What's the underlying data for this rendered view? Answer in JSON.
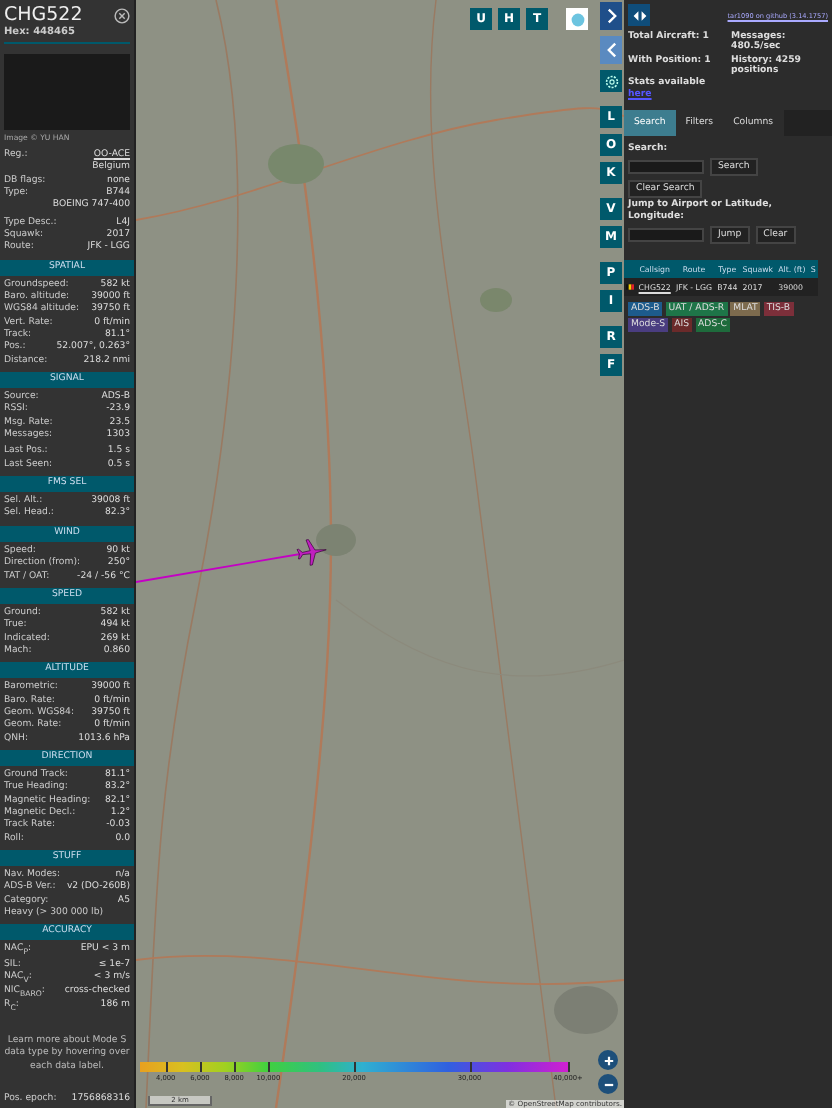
{
  "aircraft": {
    "callsign": "CHG522",
    "hex_label": "Hex:",
    "hex": "448465",
    "photo_credit": "Image © YU HAN"
  },
  "info_groups": [
    {
      "rows": [
        {
          "kind": "link",
          "label": "Reg.:",
          "value": "OO-ACE"
        },
        {
          "kind": "value",
          "value": "Belgium"
        },
        {
          "kind": "pair",
          "label": "DB flags:",
          "value": "none"
        },
        {
          "kind": "pair",
          "label": "Type:",
          "value": "B744"
        },
        {
          "kind": "value",
          "value": "BOEING 747-400"
        }
      ]
    },
    {
      "rows": [
        {
          "kind": "pair",
          "label": "Type Desc.:",
          "value": "L4J"
        },
        {
          "kind": "pair",
          "label": "Squawk:",
          "value": "2017"
        },
        {
          "kind": "pair",
          "label": "Route:",
          "value": "JFK - LGG"
        }
      ]
    }
  ],
  "sections": [
    {
      "title": "SPATIAL",
      "groups": [
        {
          "rows": [
            {
              "kind": "pair",
              "label": "Groundspeed:",
              "value": "582 kt"
            },
            {
              "kind": "pair",
              "label": "Baro. altitude:",
              "value": "39000 ft"
            },
            {
              "kind": "pair",
              "label": "WGS84 altitude:",
              "value": "39750 ft"
            },
            {
              "kind": "pair",
              "label": "Vert. Rate:",
              "value": "0 ft/min"
            },
            {
              "kind": "pair",
              "label": "Track:",
              "value": "81.1°"
            },
            {
              "kind": "pair",
              "label": "Pos.:",
              "value": "52.007°, 0.263°"
            },
            {
              "kind": "pair",
              "label": "Distance:",
              "value": "218.2 nmi"
            }
          ]
        }
      ]
    },
    {
      "title": "SIGNAL",
      "groups": [
        {
          "rows": [
            {
              "kind": "pair",
              "label": "Source:",
              "value": "ADS-B"
            },
            {
              "kind": "pair",
              "label": "RSSI:",
              "value": "-23.9"
            },
            {
              "kind": "pair",
              "label": "Msg. Rate:",
              "value": "23.5"
            },
            {
              "kind": "pair",
              "label": "Messages:",
              "value": "1303"
            }
          ]
        },
        {
          "rows": [
            {
              "kind": "pair",
              "label": "Last Pos.:",
              "value": "1.5 s"
            },
            {
              "kind": "pair",
              "label": "Last Seen:",
              "value": "0.5 s"
            }
          ]
        }
      ]
    },
    {
      "title": "FMS SEL",
      "groups": [
        {
          "rows": [
            {
              "kind": "pair",
              "label": "Sel. Alt.:",
              "value": "39008 ft"
            },
            {
              "kind": "pair",
              "label": "Sel. Head.:",
              "value": "82.3°"
            }
          ]
        }
      ]
    },
    {
      "title": "WIND",
      "groups": [
        {
          "rows": [
            {
              "kind": "pair",
              "label": "Speed:",
              "value": "90 kt"
            },
            {
              "kind": "pair",
              "label": "Direction (from):",
              "value": "250°"
            },
            {
              "kind": "pair",
              "label": "TAT / OAT:",
              "value": "-24 / -56 °C"
            }
          ]
        }
      ]
    },
    {
      "title": "SPEED",
      "groups": [
        {
          "rows": [
            {
              "kind": "pair",
              "label": "Ground:",
              "value": "582 kt"
            },
            {
              "kind": "pair",
              "label": "True:",
              "value": "494 kt"
            },
            {
              "kind": "pair",
              "label": "Indicated:",
              "value": "269 kt"
            },
            {
              "kind": "pair",
              "label": "Mach:",
              "value": "0.860"
            }
          ]
        }
      ]
    },
    {
      "title": "ALTITUDE",
      "groups": [
        {
          "rows": [
            {
              "kind": "pair",
              "label": "Barometric:",
              "value": "39000 ft"
            },
            {
              "kind": "pair",
              "label": "Baro. Rate:",
              "value": "0 ft/min"
            },
            {
              "kind": "pair",
              "label": "Geom. WGS84:",
              "value": "39750 ft"
            },
            {
              "kind": "pair",
              "label": "Geom. Rate:",
              "value": "0 ft/min"
            },
            {
              "kind": "pair",
              "label": "QNH:",
              "value": "1013.6 hPa"
            }
          ]
        }
      ]
    },
    {
      "title": "DIRECTION",
      "groups": [
        {
          "rows": [
            {
              "kind": "pair",
              "label": "Ground Track:",
              "value": "81.1°"
            },
            {
              "kind": "pair",
              "label": "True Heading:",
              "value": "83.2°"
            },
            {
              "kind": "pair",
              "label": "Magnetic Heading:",
              "value": "82.1°"
            },
            {
              "kind": "pair",
              "label": "Magnetic Decl.:",
              "value": "1.2°"
            },
            {
              "kind": "pair",
              "label": "Track Rate:",
              "value": "-0.03"
            },
            {
              "kind": "pair",
              "label": "Roll:",
              "value": "0.0"
            }
          ]
        }
      ]
    },
    {
      "title": "STUFF",
      "groups": [
        {
          "rows": [
            {
              "kind": "pair",
              "label": "Nav. Modes:",
              "value": "n/a"
            },
            {
              "kind": "pair",
              "label": "ADS-B Ver.:",
              "value": "v2 (DO-260B)"
            },
            {
              "kind": "pair",
              "label": "Category:",
              "value": "A5"
            },
            {
              "kind": "label",
              "label": "Heavy (> 300 000 lb)"
            }
          ]
        }
      ]
    },
    {
      "title": "ACCURACY",
      "groups": [
        {
          "rows": [
            {
              "kind": "pair",
              "label": "NAC$_{P}$:",
              "value": "EPU < 3 m"
            },
            {
              "kind": "pair",
              "label": "SIL:",
              "value": "≤ 1e-7"
            },
            {
              "kind": "pair",
              "label": "NAC$_{V}$:",
              "value": "< 3 m/s"
            },
            {
              "kind": "pair",
              "label": "NIC$_{BARO}$:",
              "value": "cross-checked"
            },
            {
              "kind": "pair",
              "label": "R$_{C}$:",
              "value": "186 m"
            }
          ]
        }
      ]
    }
  ],
  "note": "Learn more about Mode S data type by hovering over each data label.",
  "epoch": {
    "label": "Pos. epoch:",
    "value": "1756868316"
  },
  "map": {
    "top_buttons": [
      "U",
      "H",
      "T"
    ],
    "side_buttons": [
      [
        "L",
        "O",
        "K"
      ],
      [
        "V",
        "M"
      ],
      [
        "P",
        "I"
      ],
      [
        "R",
        "F"
      ]
    ],
    "altitude_legend": [
      "4,000",
      "6,000",
      "8,000",
      "10,000",
      "20,000",
      "30,000",
      "40,000+"
    ],
    "scale": "2 km",
    "attribution": "© OpenStreetMap contributors."
  },
  "sidebar": {
    "version_link": "tar1090 on github (3.14.1757)",
    "stats": [
      "Total Aircraft: 1",
      "Messages: 480.5/sec",
      "With Position: 1",
      "History: 4259 positions"
    ],
    "stats_text": "Stats available",
    "stats_link": "here",
    "tabs": [
      {
        "label": "Search",
        "selected": true
      },
      {
        "label": "Filters",
        "selected": false
      },
      {
        "label": "Columns",
        "selected": false
      }
    ],
    "search_label": "Search:",
    "search_button": "Search",
    "clear_search_button": "Clear Search",
    "jump_label": "Jump to Airport or Latitude, Longitude:",
    "jump_button": "Jump",
    "clear_button": "Clear",
    "table": {
      "columns": [
        "Callsign",
        "Route",
        "Type",
        "Squawk",
        "Alt. (ft)",
        "S"
      ],
      "rows": [
        {
          "callsign": "CHG522",
          "route": "JFK - LGG",
          "type": "B744",
          "squawk": "2017",
          "altitude": "39000"
        }
      ]
    },
    "sources": [
      {
        "label": "ADS-B",
        "color": "#1d5b8c"
      },
      {
        "label": "UAT / ADS-R",
        "color": "#1e7548"
      },
      {
        "label": "MLAT",
        "color": "#7d6b4e"
      },
      {
        "label": "TIS-B",
        "color": "#7c2f3a"
      },
      {
        "label": "Mode-S",
        "color": "#4a3d80"
      },
      {
        "label": "AIS",
        "color": "#6b2a2a"
      },
      {
        "label": "ADS-C",
        "color": "#1e6b3c"
      }
    ]
  }
}
